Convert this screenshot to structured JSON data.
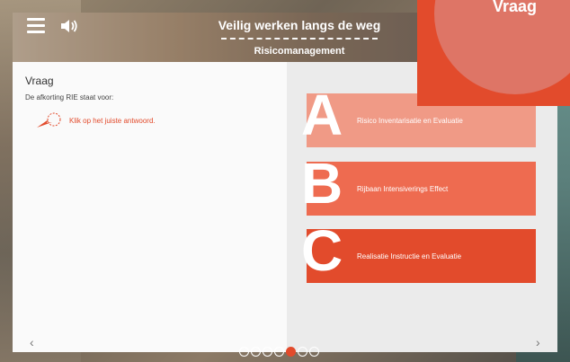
{
  "header": {
    "title": "Veilig werken langs de weg",
    "subtitle": "Risicomanagement"
  },
  "badge": {
    "label": "Vraag"
  },
  "question": {
    "heading": "Vraag",
    "text": "De afkorting RIE staat voor:",
    "hint": "Klik op het juiste antwoord."
  },
  "answers": [
    {
      "letter": "A",
      "label": "Risico Inventarisatie en Evaluatie",
      "color": "#f09a86"
    },
    {
      "letter": "B",
      "label": "Rijbaan Intensiverings Effect",
      "color": "#ee6b50"
    },
    {
      "letter": "C",
      "label": "Realisatie Instructie en Evaluatie",
      "color": "#e24b2c"
    }
  ],
  "nav": {
    "prev": "‹",
    "next": "›"
  },
  "pager": {
    "total": 7,
    "active_index": 4
  },
  "colors": {
    "accent": "#e24b2c",
    "accent_light": "#de7566"
  },
  "icons": {
    "menu": "menu-icon",
    "sound": "speaker-icon",
    "hint": "pointing-hand-icon"
  }
}
